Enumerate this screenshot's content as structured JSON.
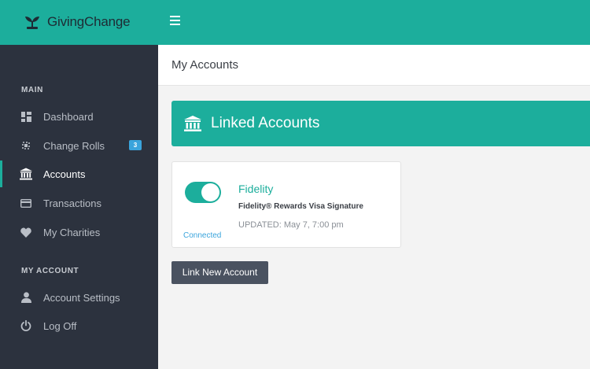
{
  "app": {
    "brand": "GivingChange"
  },
  "sidebar": {
    "sections": [
      {
        "label": "MAIN"
      },
      {
        "label": "MY ACCOUNT"
      }
    ],
    "items": [
      {
        "label": "Dashboard",
        "icon": "dashboard-icon"
      },
      {
        "label": "Change Rolls",
        "icon": "coins-icon",
        "badge": "3"
      },
      {
        "label": "Accounts",
        "icon": "bank-icon",
        "active": true
      },
      {
        "label": "Transactions",
        "icon": "credit-card-icon"
      },
      {
        "label": "My Charities",
        "icon": "heart-icon"
      },
      {
        "label": "Account Settings",
        "icon": "user-icon"
      },
      {
        "label": "Log Off",
        "icon": "power-icon"
      }
    ]
  },
  "header": {
    "title": "My Accounts"
  },
  "linked": {
    "title": "Linked Accounts",
    "accounts": [
      {
        "name": "Fidelity",
        "description": "Fidelity® Rewards Visa Signature",
        "updated": "UPDATED: May 7, 7:00 pm",
        "status": "Connected",
        "enabled": true
      }
    ]
  },
  "actions": {
    "link_new": "Link New Account"
  },
  "colors": {
    "accent": "#1cae9c",
    "sidebar": "#2c323e",
    "badge": "#3aa4dc",
    "button": "#4a5260"
  }
}
